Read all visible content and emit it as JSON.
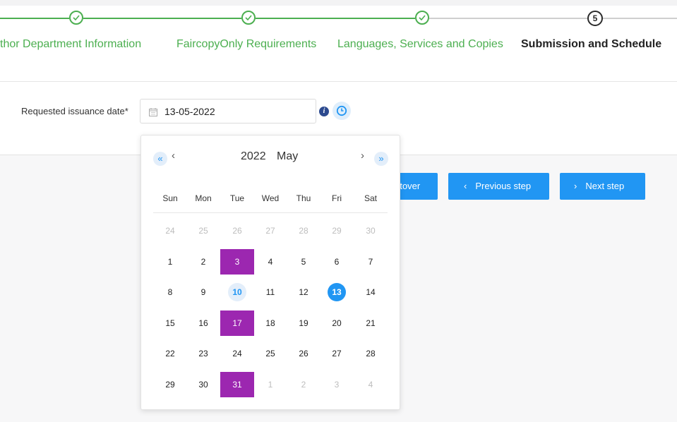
{
  "stepper": {
    "steps": [
      {
        "label": "thor Department Information",
        "status": "done"
      },
      {
        "label": "FaircopyOnly Requirements",
        "status": "done"
      },
      {
        "label": "Languages, Services and Copies",
        "status": "done"
      },
      {
        "label": "Submission and Schedule",
        "status": "current",
        "number": "5"
      }
    ]
  },
  "form": {
    "date_label": "Requested issuance date*",
    "date_value": "13-05-2022",
    "info_glyph": "i"
  },
  "buttons": {
    "startover": "rtover",
    "previous": "Previous step",
    "next": "Next step",
    "prev_chevron": "‹",
    "next_chevron": "›"
  },
  "calendar": {
    "year": "2022",
    "month": "May",
    "nav": {
      "prev_year": "«",
      "prev_month": "‹",
      "next_month": "›",
      "next_year": "»"
    },
    "weekdays": [
      "Sun",
      "Mon",
      "Tue",
      "Wed",
      "Thu",
      "Fri",
      "Sat"
    ],
    "weeks": [
      [
        {
          "d": "24",
          "m": true
        },
        {
          "d": "25",
          "m": true
        },
        {
          "d": "26",
          "m": true
        },
        {
          "d": "27",
          "m": true
        },
        {
          "d": "28",
          "m": true
        },
        {
          "d": "29",
          "m": true
        },
        {
          "d": "30",
          "m": true
        }
      ],
      [
        {
          "d": "1"
        },
        {
          "d": "2"
        },
        {
          "d": "3",
          "s": "hl"
        },
        {
          "d": "4"
        },
        {
          "d": "5"
        },
        {
          "d": "6"
        },
        {
          "d": "7"
        }
      ],
      [
        {
          "d": "8"
        },
        {
          "d": "9"
        },
        {
          "d": "10",
          "s": "today"
        },
        {
          "d": "11"
        },
        {
          "d": "12"
        },
        {
          "d": "13",
          "s": "sel"
        },
        {
          "d": "14"
        }
      ],
      [
        {
          "d": "15"
        },
        {
          "d": "16"
        },
        {
          "d": "17",
          "s": "hl"
        },
        {
          "d": "18"
        },
        {
          "d": "19"
        },
        {
          "d": "20"
        },
        {
          "d": "21"
        }
      ],
      [
        {
          "d": "22"
        },
        {
          "d": "23"
        },
        {
          "d": "24"
        },
        {
          "d": "25"
        },
        {
          "d": "26"
        },
        {
          "d": "27"
        },
        {
          "d": "28"
        }
      ],
      [
        {
          "d": "29"
        },
        {
          "d": "30"
        },
        {
          "d": "31",
          "s": "hl"
        },
        {
          "d": "1",
          "m": true
        },
        {
          "d": "2",
          "m": true
        },
        {
          "d": "3",
          "m": true
        },
        {
          "d": "4",
          "m": true
        }
      ]
    ]
  },
  "colors": {
    "step_done": "#4caf50",
    "primary": "#2196f3",
    "highlight_purple": "#9c27b0",
    "today_bg": "#e3eefa"
  }
}
